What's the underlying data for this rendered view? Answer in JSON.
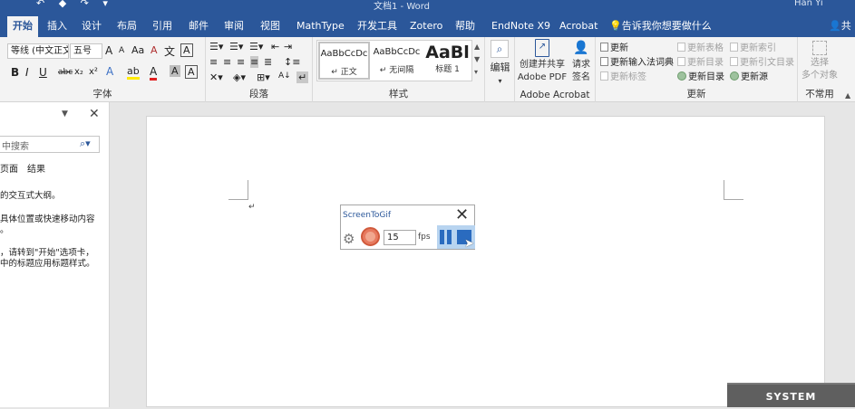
{
  "title_bar": {
    "quick_access": "↶  ◆  ↷ ▾",
    "doc_title": "文档1 - Word",
    "user": "Han Yi"
  },
  "tabs": [
    "开始",
    "插入",
    "设计",
    "布局",
    "引用",
    "邮件",
    "审阅",
    "视图",
    "MathType",
    "开发工具",
    "Zotero",
    "帮助",
    "EndNote X9",
    "Acrobat"
  ],
  "tell_me": "告诉我你想要做什么",
  "share": "共享",
  "font_group": {
    "font_name": "等线 (中文正文)",
    "font_size": "五号",
    "label": "字体",
    "grow": "A",
    "shrink": "A",
    "aa": "Aa",
    "clear": "A",
    "wen": "文",
    "a_box": "A",
    "bold": "B",
    "italic": "I",
    "underline": "U",
    "strike": "abc",
    "sub": "x₂",
    "sup": "x²",
    "effects": "A",
    "highlight": "ab",
    "color": "A",
    "char_shade": "A",
    "char_border": "A"
  },
  "para_group": {
    "label": "段落",
    "sort": "A↓",
    "marks": "↵"
  },
  "styles_group": {
    "label": "样式",
    "items": [
      {
        "preview": "AaBbCcDc",
        "name": "正文"
      },
      {
        "preview": "AaBbCcDc",
        "name": "无间隔"
      },
      {
        "preview": "AaBl",
        "name": "标题 1"
      }
    ]
  },
  "edit_group": {
    "label": "编辑"
  },
  "acrobat_group": {
    "create_pdf": "创建并共享",
    "create_pdf2": "Adobe PDF",
    "request_sign": "请求",
    "request_sign2": "签名",
    "label": "Adobe Acrobat"
  },
  "update_group": {
    "label": "更新",
    "items": [
      {
        "text": "更新",
        "enabled": true
      },
      {
        "text": "更新表格",
        "enabled": false
      },
      {
        "text": "更新索引",
        "enabled": false
      },
      {
        "text": "更新输入法词典",
        "enabled": true
      },
      {
        "text": "更新目录",
        "enabled": false
      },
      {
        "text": "更新引文目录",
        "enabled": false
      },
      {
        "text": "更新标签",
        "enabled": false
      },
      {
        "text": "更新目录",
        "enabled": true
      },
      {
        "text": "更新源",
        "enabled": true
      }
    ]
  },
  "select_group": {
    "line1": "选择",
    "line2": "多个对象",
    "label": "不常用"
  },
  "nav_pane": {
    "search_placeholder": "中搜索",
    "tabs": [
      "页面",
      "结果"
    ],
    "text1": "的交互式大纲。",
    "text2": "具体位置或快速移动内容",
    "text3": "。",
    "text4": "，请转到\"开始\"选项卡，",
    "text5": "中的标题应用标题样式。"
  },
  "document": {
    "para_mark": "↵"
  },
  "screentogif": {
    "title": "ScreenToGif",
    "fps_value": "15",
    "fps_label": "fps"
  },
  "system_badge": "SYSTEM"
}
